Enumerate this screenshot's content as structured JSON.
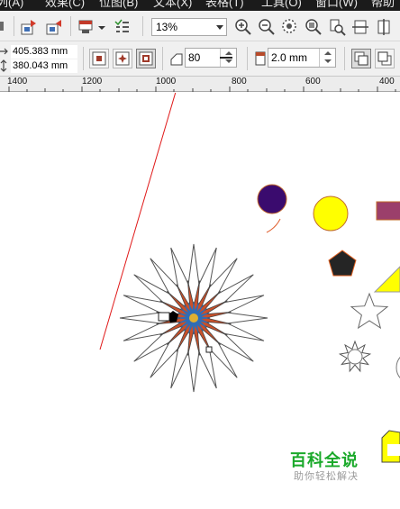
{
  "menubar": {
    "items": [
      {
        "label": "列(A)"
      },
      {
        "label": "效果(C)"
      },
      {
        "label": "位图(B)"
      },
      {
        "label": "文本(X)"
      },
      {
        "label": "表格(T)"
      },
      {
        "label": "工具(O)"
      },
      {
        "label": "窗口(W)"
      },
      {
        "label": "帮助"
      }
    ]
  },
  "toolbar": {
    "zoom_value": "13%"
  },
  "property_bar": {
    "x_value": "405.383 mm",
    "y_value": "380.043 mm",
    "points_value": "80",
    "outline_width_value": "2.0 mm"
  },
  "ruler": {
    "labels": [
      "1400",
      "1200",
      "1000",
      "800",
      "600",
      "400"
    ]
  },
  "watermark": {
    "title": "百科全说",
    "subtitle": "助你轻松解决"
  },
  "colors": {
    "purple_circle": "#3a0b6e",
    "yellow_circle": "#ffff00",
    "magenta_rect": "#9b3f6b",
    "star_fill": "#c8502a",
    "star_center": "#2f6db6",
    "annotation_line": "#e01818",
    "watermark_green": "#1aa92a"
  }
}
